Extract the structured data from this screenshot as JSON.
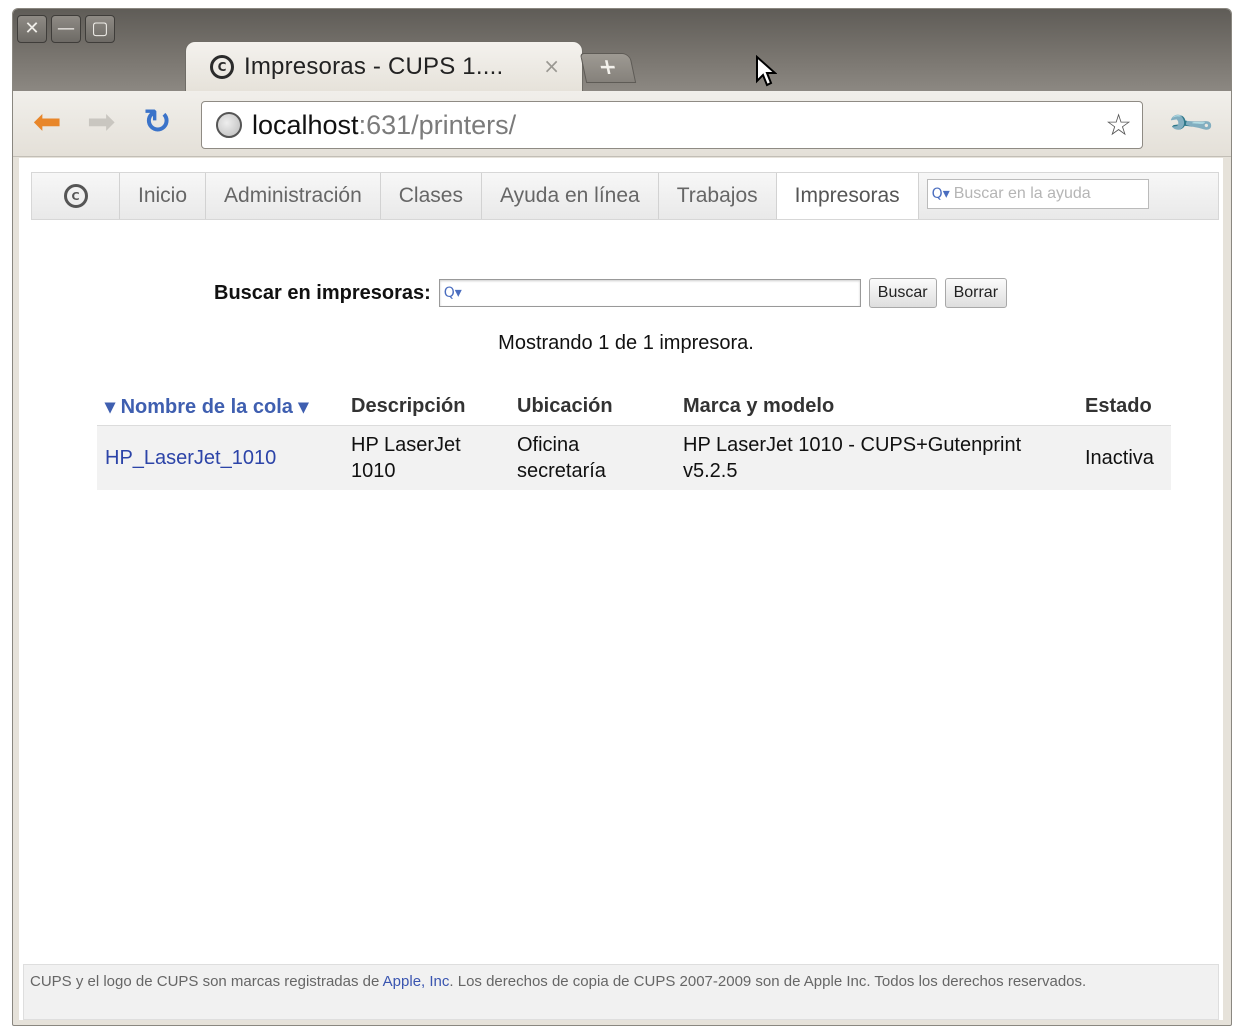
{
  "window": {
    "close_glyph": "✕",
    "minimize_glyph": "—",
    "maximize_glyph": "▢",
    "tab_icon_glyph": "C",
    "tab_title": "Impresoras - CUPS 1....",
    "tab_close_glyph": "×",
    "new_tab_glyph": "+"
  },
  "toolbar": {
    "back_glyph": "⬅",
    "forward_glyph": "➡",
    "reload_glyph": "↻",
    "url_host": "localhost",
    "url_rest": ":631/printers/",
    "star_glyph": "☆",
    "wrench_glyph": "🔧"
  },
  "nav": {
    "logo_glyph": "C",
    "items": [
      {
        "label": "Inicio"
      },
      {
        "label": "Administración"
      },
      {
        "label": "Clases"
      },
      {
        "label": "Ayuda en línea"
      },
      {
        "label": "Trabajos"
      },
      {
        "label": "Impresoras",
        "active": true
      }
    ],
    "search_placeholder": "Buscar en la ayuda",
    "search_icon_glyph": "Q▾"
  },
  "search": {
    "label": "Buscar en impresoras:",
    "value": "",
    "icon_glyph": "Q▾",
    "search_button": "Buscar",
    "clear_button": "Borrar"
  },
  "summary": "Mostrando 1 de 1 impresora.",
  "table": {
    "columns": [
      "▾ Nombre de la cola ▾",
      "Descripción",
      "Ubicación",
      "Marca y modelo",
      "Estado"
    ],
    "rows": [
      {
        "name": "HP_LaserJet_1010",
        "description": "HP LaserJet 1010",
        "location": "Oficina secretaría",
        "make_model": "HP LaserJet 1010 - CUPS+Gutenprint v5.2.5",
        "state": "Inactiva"
      }
    ]
  },
  "footer": {
    "text_before": "CUPS y el logo de CUPS son marcas registradas de ",
    "link": "Apple, Inc",
    "text_after": ". Los derechos de copia de CUPS 2007-2009 son de Apple Inc. Todos los derechos reservados."
  },
  "colors": {
    "link": "#2c44a8",
    "sort_header": "#3f5fb0",
    "row_bg": "#f2f2f2"
  }
}
